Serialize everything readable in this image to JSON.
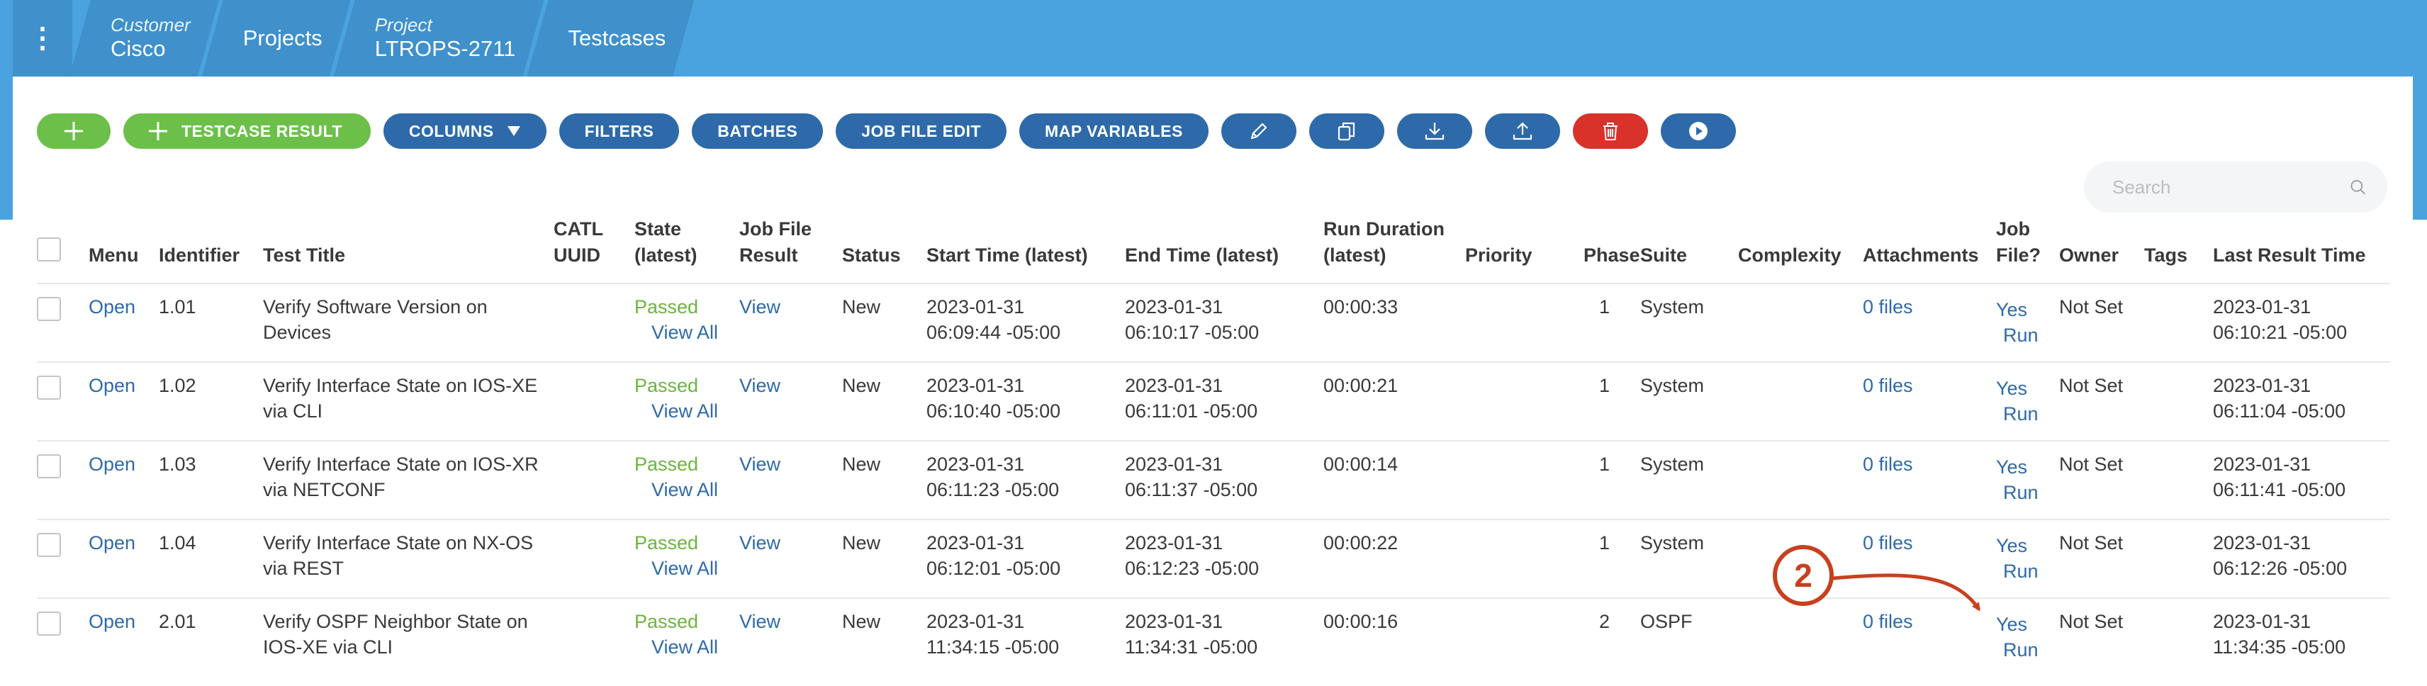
{
  "breadcrumb": {
    "customer_label": "Customer",
    "customer_value": "Cisco",
    "projects": "Projects",
    "project_label": "Project",
    "project_value": "LTROPS-2711",
    "testcases": "Testcases"
  },
  "toolbar": {
    "add_label": "+",
    "testcase_result_label": "TESTCASE RESULT",
    "columns_label": "COLUMNS",
    "filters_label": "FILTERS",
    "batches_label": "BATCHES",
    "job_file_edit_label": "JOB FILE EDIT",
    "map_variables_label": "MAP VARIABLES"
  },
  "search": {
    "placeholder": "Search"
  },
  "table": {
    "headers": {
      "menu": "Menu",
      "identifier": "Identifier",
      "test_title": "Test Title",
      "catl_uuid_1": "CATL",
      "catl_uuid_2": "UUID",
      "state_1": "State",
      "state_2": "(latest)",
      "job_file_result_1": "Job File",
      "job_file_result_2": "Result",
      "status": "Status",
      "start_time": "Start Time (latest)",
      "end_time": "End Time (latest)",
      "run_duration_1": "Run Duration",
      "run_duration_2": "(latest)",
      "priority": "Priority",
      "phase": "Phase",
      "suite": "Suite",
      "complexity": "Complexity",
      "attachments": "Attachments",
      "job_file_1": "Job",
      "job_file_2": "File?",
      "owner": "Owner",
      "tags": "Tags",
      "last_result_time": "Last Result Time"
    },
    "rows": [
      {
        "menu": "Open",
        "identifier": "1.01",
        "title_1": "Verify Software Version on",
        "title_2": "Devices",
        "state": "Passed",
        "view_all": "View All",
        "job_result": "View",
        "status": "New",
        "start_1": "2023-01-31",
        "start_2": "06:09:44 -05:00",
        "end_1": "2023-01-31",
        "end_2": "06:10:17 -05:00",
        "duration": "00:00:33",
        "phase": "1",
        "suite": "System",
        "attachments": "0 files",
        "job_file": "Yes",
        "run": "Run",
        "owner": "Not Set",
        "last_1": "2023-01-31",
        "last_2": "06:10:21 -05:00"
      },
      {
        "menu": "Open",
        "identifier": "1.02",
        "title_1": "Verify Interface State on IOS-XE",
        "title_2": "via CLI",
        "state": "Passed",
        "view_all": "View All",
        "job_result": "View",
        "status": "New",
        "start_1": "2023-01-31",
        "start_2": "06:10:40 -05:00",
        "end_1": "2023-01-31",
        "end_2": "06:11:01 -05:00",
        "duration": "00:00:21",
        "phase": "1",
        "suite": "System",
        "attachments": "0 files",
        "job_file": "Yes",
        "run": "Run",
        "owner": "Not Set",
        "last_1": "2023-01-31",
        "last_2": "06:11:04 -05:00"
      },
      {
        "menu": "Open",
        "identifier": "1.03",
        "title_1": "Verify Interface State on IOS-XR",
        "title_2": "via NETCONF",
        "state": "Passed",
        "view_all": "View All",
        "job_result": "View",
        "status": "New",
        "start_1": "2023-01-31",
        "start_2": "06:11:23 -05:00",
        "end_1": "2023-01-31",
        "end_2": "06:11:37 -05:00",
        "duration": "00:00:14",
        "phase": "1",
        "suite": "System",
        "attachments": "0 files",
        "job_file": "Yes",
        "run": "Run",
        "owner": "Not Set",
        "last_1": "2023-01-31",
        "last_2": "06:11:41 -05:00"
      },
      {
        "menu": "Open",
        "identifier": "1.04",
        "title_1": "Verify Interface State on NX-OS",
        "title_2": "via REST",
        "state": "Passed",
        "view_all": "View All",
        "job_result": "View",
        "status": "New",
        "start_1": "2023-01-31",
        "start_2": "06:12:01 -05:00",
        "end_1": "2023-01-31",
        "end_2": "06:12:23 -05:00",
        "duration": "00:00:22",
        "phase": "1",
        "suite": "System",
        "attachments": "0 files",
        "job_file": "Yes",
        "run": "Run",
        "owner": "Not Set",
        "last_1": "2023-01-31",
        "last_2": "06:12:26 -05:00"
      },
      {
        "menu": "Open",
        "identifier": "2.01",
        "title_1": "Verify OSPF Neighbor State on",
        "title_2": "IOS-XE via CLI",
        "state": "Passed",
        "view_all": "View All",
        "job_result": "View",
        "status": "New",
        "start_1": "2023-01-31",
        "start_2": "11:34:15 -05:00",
        "end_1": "2023-01-31",
        "end_2": "11:34:31 -05:00",
        "duration": "00:00:16",
        "phase": "2",
        "suite": "OSPF",
        "attachments": "0 files",
        "job_file": "Yes",
        "run": "Run",
        "owner": "Not Set",
        "last_1": "2023-01-31",
        "last_2": "11:34:35 -05:00"
      }
    ]
  },
  "annotation": {
    "number": "2",
    "color": "#c8401f"
  },
  "colors": {
    "header_blue": "#4aa3de",
    "button_blue": "#2e6aa9",
    "button_green": "#6cc04a",
    "button_red": "#d8322b",
    "link": "#2e6aa9",
    "passed": "#6cb43f"
  }
}
